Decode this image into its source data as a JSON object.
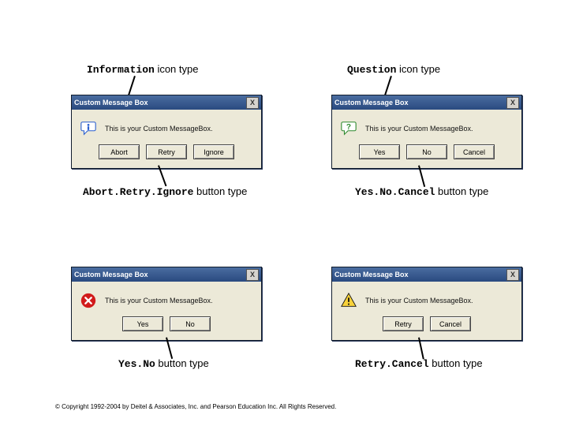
{
  "captions": {
    "info": {
      "code": "Information",
      "tail": " icon type"
    },
    "question": {
      "code": "Question",
      "tail": " icon type"
    },
    "ari": {
      "code": "Abort.Retry.Ignore",
      "tail": " button type"
    },
    "ync": {
      "code": "Yes.No.Cancel",
      "tail": " button type"
    },
    "yn": {
      "code": "Yes.No",
      "tail": " button type"
    },
    "rc": {
      "code": "Retry.Cancel",
      "tail": " button type"
    }
  },
  "dlg": {
    "title": "Custom Message Box",
    "close": "X",
    "msg": "This is your Custom MessageBox."
  },
  "buttons": {
    "abort": "Abort",
    "retry": "Retry",
    "ignore": "Ignore",
    "yes": "Yes",
    "no": "No",
    "cancel": "Cancel"
  },
  "footer": "© Copyright 1992-2004 by Deitel & Associates, Inc. and Pearson Education Inc. All Rights Reserved."
}
